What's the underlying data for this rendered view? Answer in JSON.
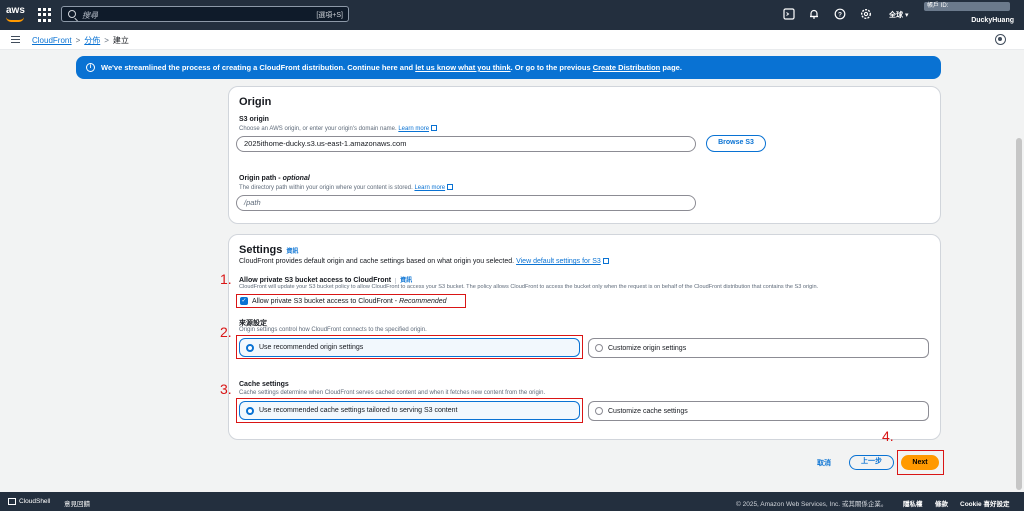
{
  "topnav": {
    "logo": "aws",
    "search_placeholder": "搜尋",
    "search_shortcut": "[選項+S]",
    "region": "全球 ▾",
    "account_id_label": "帳戶 ID: ",
    "username": "DuckyHuang",
    "icons": [
      "cloudshell-icon",
      "bell-icon",
      "help-icon",
      "gear-icon"
    ]
  },
  "breadcrumb": {
    "items": [
      "CloudFront",
      "分佈",
      "建立"
    ]
  },
  "flash": {
    "text_before": "We've streamlined the process of creating a CloudFront distribution. Continue here and ",
    "link1": "let us know what you think",
    "text_mid": ". Or go to the previous ",
    "link2": "Create Distribution",
    "text_after": " page."
  },
  "origin": {
    "title": "Origin",
    "s3_label": "S3 origin",
    "s3_desc": "Choose an AWS origin, or enter your origin's domain name.",
    "learn_more": "Learn more",
    "s3_value": "2025ithome-ducky.s3.us-east-1.amazonaws.com",
    "browse_button": "Browse S3",
    "path_label": "Origin path - ",
    "path_optional": "optional",
    "path_desc": "The directory path within your origin where your content is stored.",
    "path_placeholder": "/path"
  },
  "settings": {
    "title": "Settings",
    "info": "資訊",
    "desc": "CloudFront provides default origin and cache settings based on what origin you selected.",
    "view_defaults": "View default settings for S3",
    "private_label": "Allow private S3 bucket access to CloudFront",
    "private_info": "資訊",
    "private_desc": "CloudFront will update your S3 bucket policy to allow CloudFront to access your S3 bucket. The policy allows CloudFront to access the bucket only when the request is on behalf of the CloudFront distribution that contains the S3 origin.",
    "private_checkbox": "Allow private S3 bucket access to CloudFront - ",
    "private_checkbox_rec": "Recommended",
    "origin_settings_label": "來源設定",
    "origin_settings_desc": "Origin settings control how CloudFront connects to the specified origin.",
    "origin_opt1": "Use recommended origin settings",
    "origin_opt2": "Customize origin settings",
    "cache_label": "Cache settings",
    "cache_desc": "Cache settings determine when CloudFront serves cached content and when it fetches new content from the origin.",
    "cache_opt1": "Use recommended cache settings tailored to serving S3 content",
    "cache_opt2": "Customize cache settings"
  },
  "annotations": {
    "n1": "1.",
    "n2": "2.",
    "n3": "3.",
    "n4": "4."
  },
  "actions": {
    "cancel": "取消",
    "back": "上一步",
    "next": "Next"
  },
  "footer": {
    "cloudshell": "CloudShell",
    "feedback": "意見回饋",
    "copyright": "© 2025, Amazon Web Services, Inc. 或其關係企業。",
    "privacy": "隱私權",
    "terms": "條款",
    "cookie": "Cookie 喜好設定"
  },
  "colors": {
    "nav_bg": "#232f3e",
    "accent": "#0972d3",
    "primary_button": "#ff9900",
    "annotation_red": "#d91515"
  }
}
